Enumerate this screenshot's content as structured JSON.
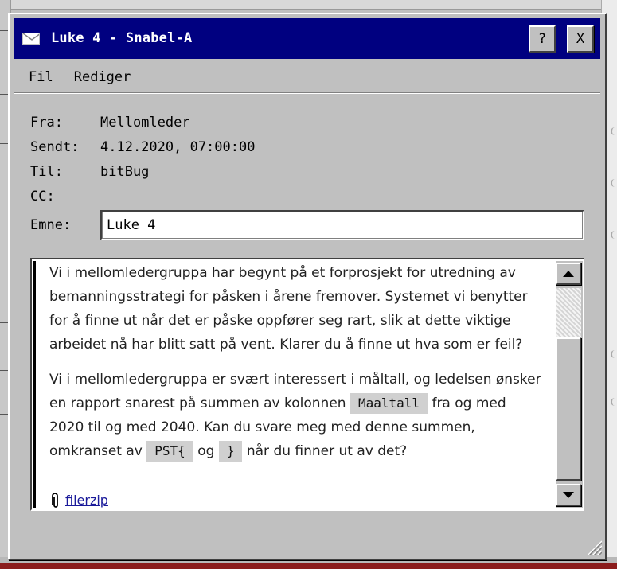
{
  "window": {
    "title": "Luke 4 - Snabel-A",
    "help_label": "?",
    "close_label": "X"
  },
  "menu": {
    "file": "Fil",
    "edit": "Rediger"
  },
  "header": {
    "from_label": "Fra:",
    "from_value": "Mellomleder",
    "sent_label": "Sendt:",
    "sent_value": "4.12.2020, 07:00:00",
    "to_label": "Til:",
    "to_value": "bitBug",
    "cc_label": "CC:",
    "cc_value": "",
    "subject_label": "Emne:",
    "subject_value": "Luke 4"
  },
  "body": {
    "p1": "Vi i mellomledergruppa har begynt på et forprosjekt for utredning av bemanningsstrategi for påsken i årene fremover. Systemet vi benytter for å finne ut når det er påske oppfører seg rart, slik at dette viktige arbeidet nå har blitt satt på vent. Klarer du å finne ut hva som er feil?",
    "p2_a": "Vi i mellomledergruppa er svært interessert i måltall, og ledelsen ønsker en rapport snarest på summen av kolonnen",
    "p2_code1": "Maaltall",
    "p2_b": "fra og med 2020 til og med 2040. Kan du svare meg med denne summen, omkranset av",
    "p2_code2": "PST{",
    "p2_c": "og",
    "p2_code3": "}",
    "p2_d": "når du finner ut av det?"
  },
  "attachment": {
    "icon": "paperclip-icon",
    "name": "filerzip"
  },
  "colors": {
    "titlebar": "#000080",
    "window": "#c0c0c0",
    "link": "#1a1a9a"
  }
}
